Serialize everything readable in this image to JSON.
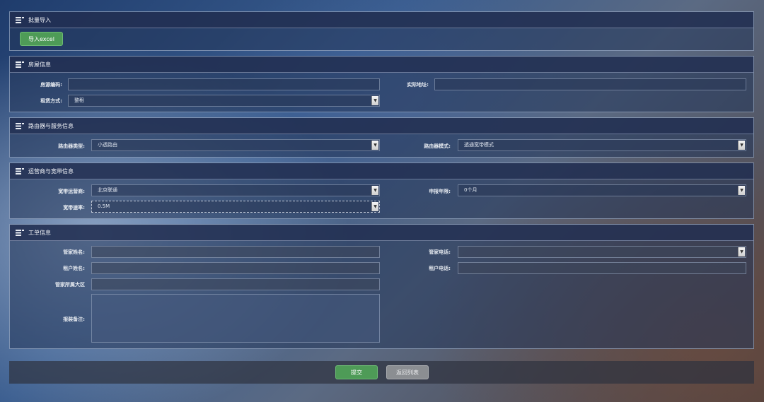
{
  "batch_import": {
    "title": "批量导入",
    "import_button": "导入excel"
  },
  "house_info": {
    "title": "房屋信息",
    "source_code_label": "房源编码:",
    "source_code_value": "",
    "address_label": "实际地址:",
    "address_value": "",
    "rent_type_label": "租赁方式:",
    "rent_type_value": "整租"
  },
  "router_info": {
    "title": "路由器与服务信息",
    "router_type_label": "路由器类型:",
    "router_type_value": "小透路由",
    "router_mode_label": "路由器模式:",
    "router_mode_value": "透通宽带模式"
  },
  "operator_info": {
    "title": "运营商与宽带信息",
    "operator_label": "宽带运营商:",
    "operator_value": "北京联通",
    "report_years_label": "申报年限:",
    "report_years_value": "0个月",
    "speed_label": "宽带速率:",
    "speed_value": "0.5M"
  },
  "work_order": {
    "title": "工单信息",
    "manager_name_label": "管家姓名:",
    "manager_name_value": "",
    "manager_phone_label": "管家电话:",
    "manager_phone_value": "",
    "tenant_name_label": "租户姓名:",
    "tenant_name_value": "",
    "tenant_phone_label": "租户电话:",
    "tenant_phone_value": "",
    "manager_region_label": "管家所属大区",
    "manager_region_value": "",
    "remark_label": "报装备注:",
    "remark_value": ""
  },
  "footer": {
    "submit_button": "提交",
    "back_button": "返回列表"
  },
  "colors": {
    "accent_green": "#4e9b57",
    "button_gray": "#8b8e92"
  }
}
